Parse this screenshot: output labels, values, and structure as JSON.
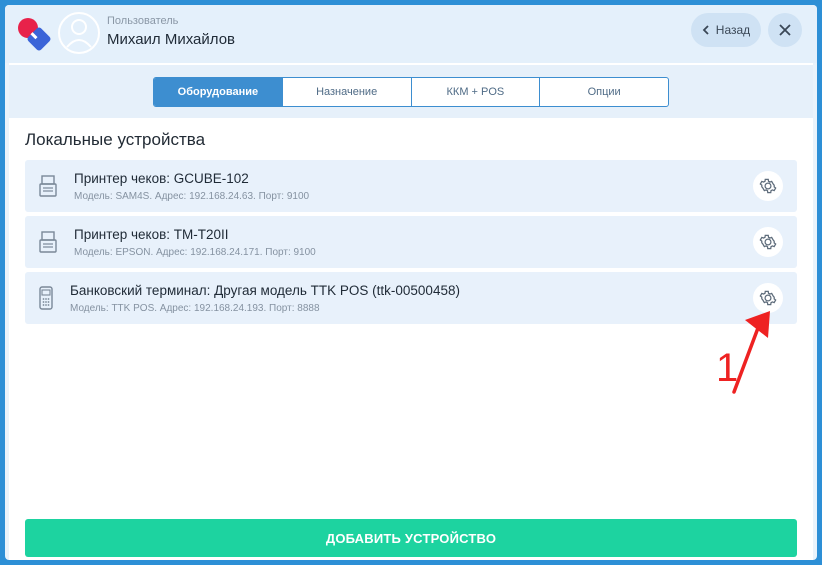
{
  "header": {
    "user_role": "Пользователь",
    "user_name": "Михаил Михайлов",
    "back_label": "Назад"
  },
  "tabs": [
    {
      "label": "Оборудование",
      "active": true
    },
    {
      "label": "Назначение",
      "active": false
    },
    {
      "label": "ККМ + POS",
      "active": false
    },
    {
      "label": "Опции",
      "active": false
    }
  ],
  "section_title": "Локальные устройства",
  "devices": [
    {
      "title": "Принтер чеков: GCUBE-102",
      "meta": "Модель: SAM4S. Адрес: 192.168.24.63. Порт: 9100",
      "icon": "printer-icon"
    },
    {
      "title": "Принтер чеков: TM-T20II",
      "meta": "Модель: EPSON. Адрес: 192.168.24.171. Порт: 9100",
      "icon": "printer-icon"
    },
    {
      "title": "Банковский терминал: Другая модель TTK POS (ttk-00500458)",
      "meta": "Модель: TTK POS. Адрес: 192.168.24.193. Порт: 8888",
      "icon": "terminal-icon"
    }
  ],
  "add_button_label": "ДОБАВИТЬ УСТРОЙСТВО",
  "annotation": {
    "number": "1",
    "color": "#ee2222"
  },
  "colors": {
    "accent": "#3d8ed0",
    "add_button": "#1dd3a0",
    "background": "#2d8fd6"
  }
}
